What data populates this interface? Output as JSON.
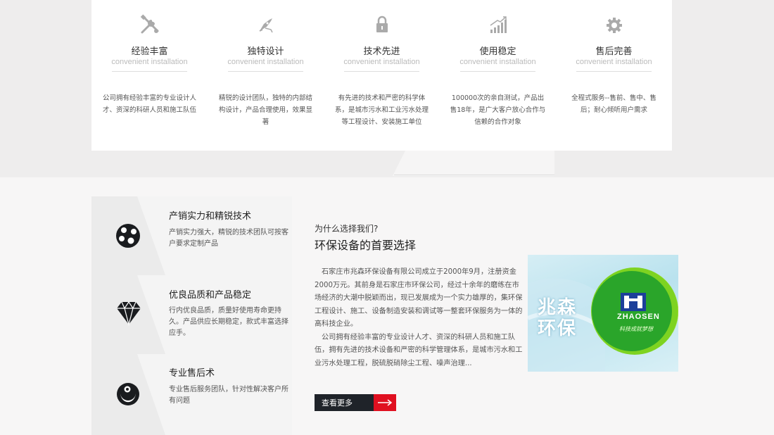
{
  "features": [
    {
      "icon": "tools-icon",
      "title": "经验丰富",
      "subtitle": "convenient installation",
      "desc": "公司拥有经验丰富的专业设计人才、资深的科研人员和施工队伍"
    },
    {
      "icon": "design-pen-icon",
      "title": "独特设计",
      "subtitle": "convenient installation",
      "desc": "精锐的设计团队，独特的内部结构设计，产品合理使用，效果显著"
    },
    {
      "icon": "lock-icon",
      "title": "技术先进",
      "subtitle": "convenient installation",
      "desc": "有先进的技术和严密的科学体系，是城市污水和工业污水处理等工程设计、安装施工单位"
    },
    {
      "icon": "growth-chart-icon",
      "title": "使用稳定",
      "subtitle": "convenient installation",
      "desc": "100000次的亲自测试，产品出售18年，是广大客户放心合作与信赖的合作对象"
    },
    {
      "icon": "gear-icon",
      "title": "售后完善",
      "subtitle": "convenient installation",
      "desc": "全程式服务--售前、售中、售后；耐心倾听用户需求"
    }
  ],
  "services": [
    {
      "title": "产销实力和精锐技术",
      "desc": "产销实力强大，精锐的技术团队可按客户要求定制产品"
    },
    {
      "title": "优良品质和产品稳定",
      "desc": "行内优良品质，质量好使用寿命更持久。产品供应长期稳定，款式丰富选择应手。"
    },
    {
      "title": "专业售后术",
      "desc": "专业售后服务团队，针对性解决客户所有问题"
    }
  ],
  "about": {
    "question": "为什么选择我们?",
    "title": "环保设备的首要选择",
    "para1": "石家庄市兆森环保设备有限公司成立于2000年9月，注册资金2000万元。其前身是石家庄市环保公司，经过十余年的磨练在市场经济的大潮中脱颖而出，现已发展成为一个实力雄厚的，集环保工程设计、施工、设备制造安装和调试等一整套环保服务为一体的高科技企业。",
    "para2": "公司拥有经验丰富的专业设计人才、资深的科研人员和施工队伍，拥有先进的技术设备和严密的科学管理体系，是城市污水和工业污水处理工程，脱硫脱硝除尘工程、噪声治理...",
    "more_label": "查看更多"
  },
  "logo": {
    "cn_name": "兆森环保",
    "en_name": "ZHAOSEN",
    "slogan": "科技成就梦想"
  },
  "colors": {
    "accent_red": "#e01020",
    "dark_btn": "#1f2329",
    "logo_green": "#2a9a2a"
  }
}
